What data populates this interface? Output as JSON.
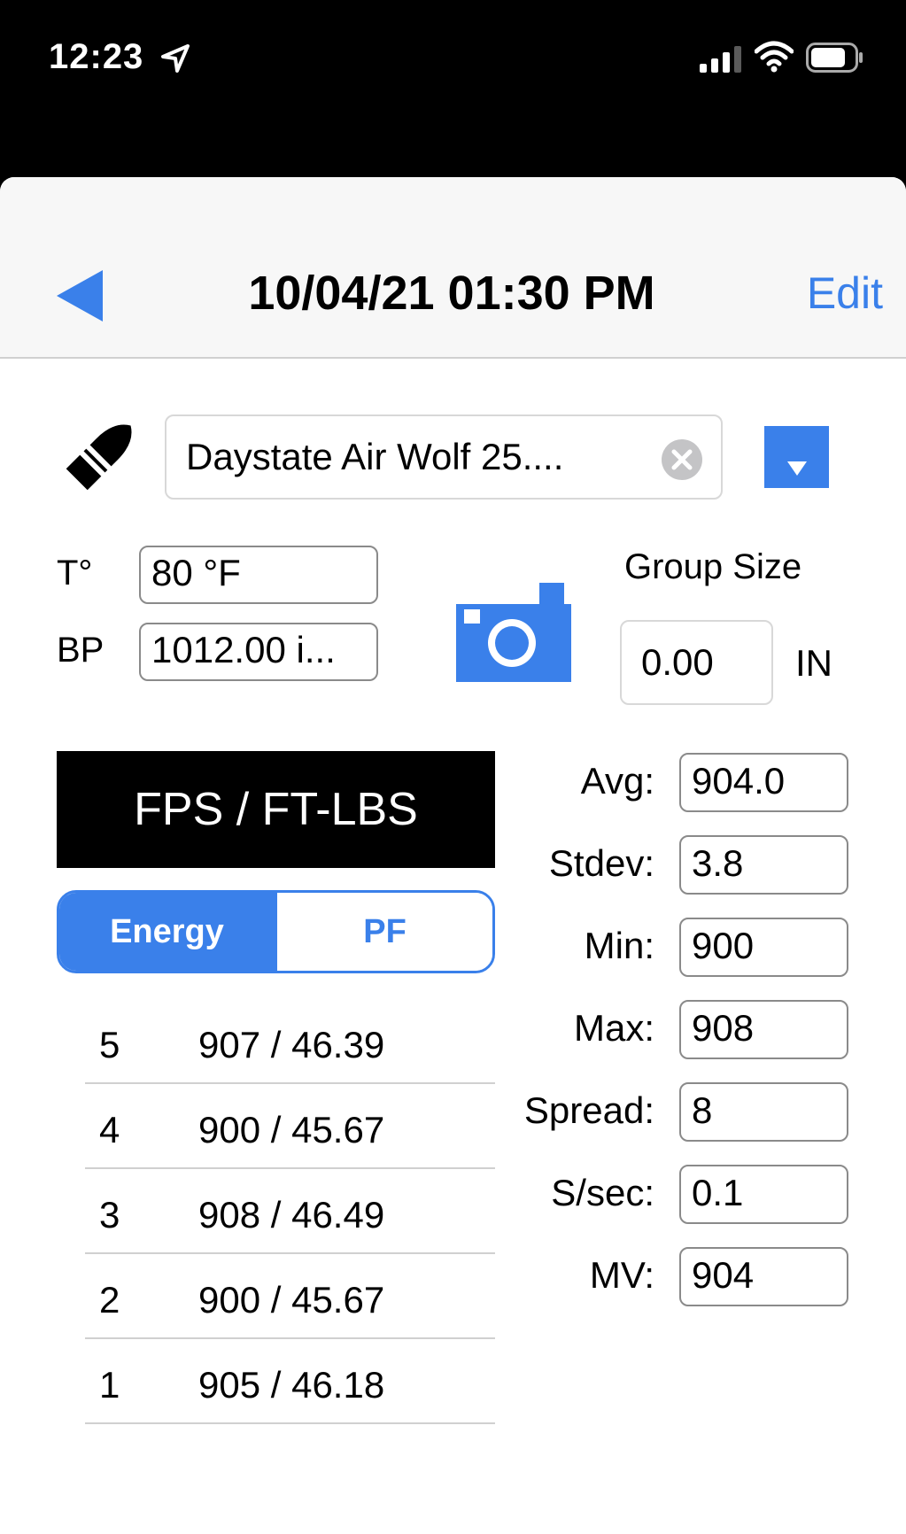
{
  "status_bar": {
    "time": "12:23"
  },
  "nav": {
    "title": "10/04/21 01:30 PM",
    "edit_label": "Edit"
  },
  "gun": {
    "name": "Daystate Air Wolf 25...."
  },
  "conditions": {
    "temp_label": "T°",
    "temp_value": "80 °F",
    "bp_label": "BP",
    "bp_value": "1012.00 i..."
  },
  "group": {
    "label": "Group Size",
    "value": "0.00",
    "unit": "IN"
  },
  "mode": {
    "header": "FPS / FT-LBS",
    "segments": [
      "Energy",
      "PF"
    ],
    "selected": "Energy"
  },
  "shots": [
    {
      "num": "5",
      "value": "907 / 46.39"
    },
    {
      "num": "4",
      "value": "900 / 45.67"
    },
    {
      "num": "3",
      "value": "908 / 46.49"
    },
    {
      "num": "2",
      "value": "900 / 45.67"
    },
    {
      "num": "1",
      "value": "905 / 46.18"
    }
  ],
  "stats": [
    {
      "label": "Avg:",
      "value": "904.0"
    },
    {
      "label": "Stdev:",
      "value": "3.8"
    },
    {
      "label": "Min:",
      "value": "900"
    },
    {
      "label": "Max:",
      "value": "908"
    },
    {
      "label": "Spread:",
      "value": "8"
    },
    {
      "label": "S/sec:",
      "value": "0.1"
    },
    {
      "label": "MV:",
      "value": "904"
    }
  ],
  "colors": {
    "accent": "#3a80ea",
    "header_bg": "#000000"
  }
}
